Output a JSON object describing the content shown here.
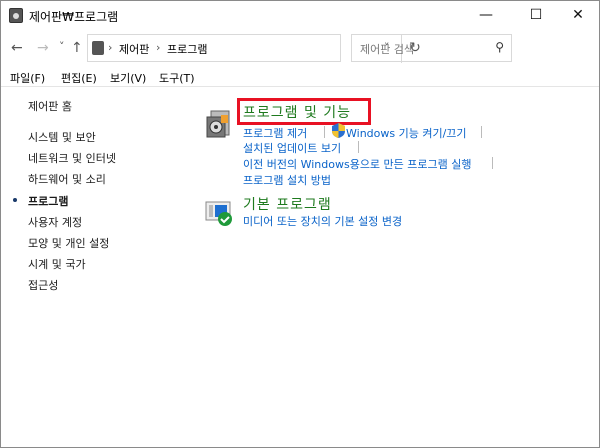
{
  "window": {
    "title": "제어판₩프로그램",
    "minimize": "—",
    "maximize": "☐",
    "close": "✕"
  },
  "nav": {
    "back": "←",
    "forward": "→",
    "recent": "˅",
    "up": "↑",
    "breadcrumb": [
      "제어판",
      "프로그램"
    ],
    "sep": "›",
    "dropdown": "˅",
    "refresh": "↻",
    "search_placeholder": "제어판 검색",
    "search_icon": "⚲"
  },
  "menu": [
    "파일(F)",
    "편집(E)",
    "보기(V)",
    "도구(T)"
  ],
  "sidebar": {
    "items": [
      "제어판 홈",
      "시스템 및 보안",
      "네트워크 및 인터넷",
      "하드웨어 및 소리",
      "프로그램",
      "사용자 계정",
      "모양 및 개인 설정",
      "시계 및 국가",
      "접근성"
    ],
    "current": "프로그램"
  },
  "sections": [
    {
      "title": "프로그램 및 기능",
      "links": [
        "프로그램 제거",
        "Windows 기능 켜기/끄기",
        "설치된 업데이트 보기",
        "이전 버전의 Windows용으로 만든 프로그램 실행",
        "프로그램 설치 방법"
      ]
    },
    {
      "title": "기본 프로그램",
      "links": [
        "미디어 또는 장치의 기본 설정 변경"
      ]
    }
  ]
}
